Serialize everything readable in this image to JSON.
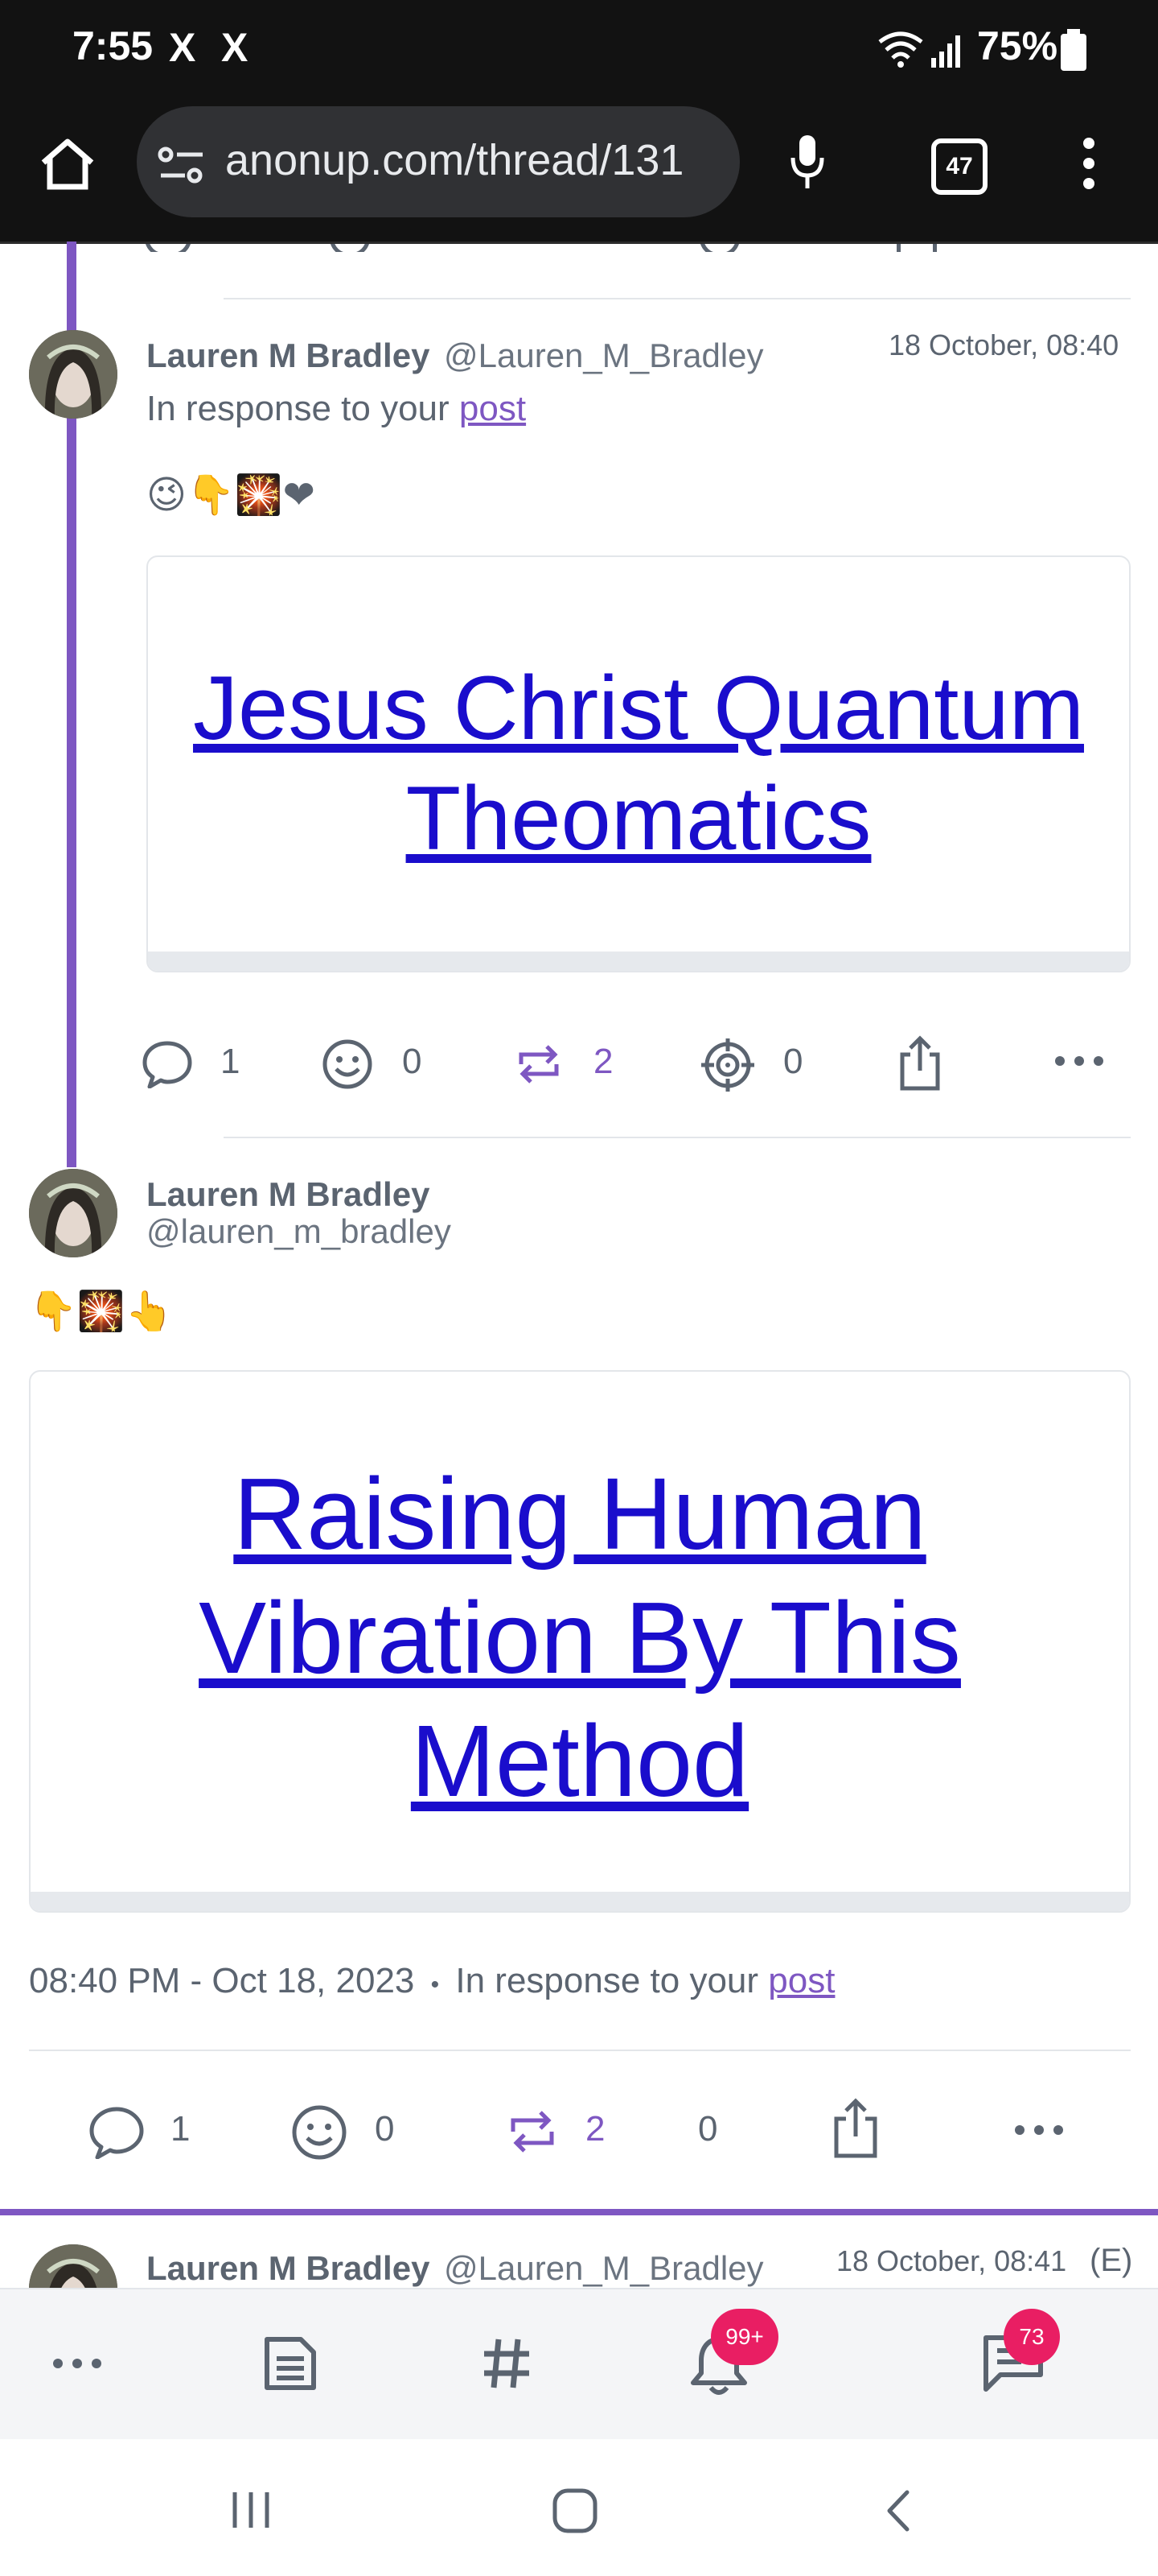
{
  "status_bar": {
    "time": "7:55",
    "app_marks": [
      "X",
      "X"
    ],
    "battery": "75%"
  },
  "browser": {
    "url": "anonup.com/thread/131",
    "tab_count": "47"
  },
  "posts": [
    {
      "author": "Lauren M Bradley",
      "handle": "@Lauren_M_Bradley",
      "date": "18 October, 08:40",
      "response_prefix": "In response to your",
      "response_link": "post",
      "emojis": "😉👇🎇❤",
      "card_title": "Jesus Christ Quantum Theomatics",
      "actions": {
        "comments": "1",
        "reactions": "0",
        "reposts": "2",
        "targets": "0"
      }
    },
    {
      "author": "Lauren M Bradley",
      "handle": "@lauren_m_bradley",
      "emojis": "👇🎇👆",
      "card_title": "Raising Human Vibration By This Method",
      "timestamp": "08:40 PM - Oct 18, 2023",
      "bullet": "•",
      "response_prefix": "In response to your",
      "response_link": "post",
      "actions": {
        "comments": "1",
        "reactions": "0",
        "reposts": "2",
        "targets": "0"
      }
    },
    {
      "author": "Lauren M Bradley",
      "handle": "@Lauren_M_Bradley",
      "date": "18 October, 08:41",
      "edited": "(E)"
    }
  ],
  "bottom_nav": {
    "notifications_badge": "99+",
    "messages_badge": "73"
  },
  "colors": {
    "accent": "#7e57c2",
    "link": "#1a0dcc",
    "badge": "#e91e63",
    "text": "#5b6470"
  }
}
